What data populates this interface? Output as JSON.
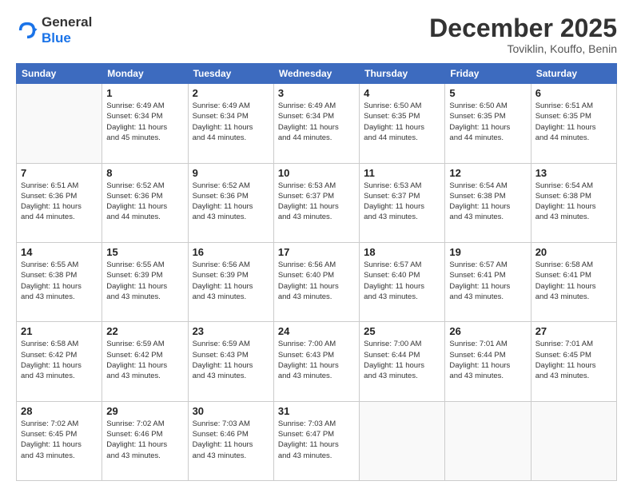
{
  "logo": {
    "line1": "General",
    "line2": "Blue"
  },
  "header": {
    "month": "December 2025",
    "location": "Toviklin, Kouffo, Benin"
  },
  "weekdays": [
    "Sunday",
    "Monday",
    "Tuesday",
    "Wednesday",
    "Thursday",
    "Friday",
    "Saturday"
  ],
  "weeks": [
    [
      {
        "day": "",
        "info": ""
      },
      {
        "day": "1",
        "info": "Sunrise: 6:49 AM\nSunset: 6:34 PM\nDaylight: 11 hours\nand 45 minutes."
      },
      {
        "day": "2",
        "info": "Sunrise: 6:49 AM\nSunset: 6:34 PM\nDaylight: 11 hours\nand 44 minutes."
      },
      {
        "day": "3",
        "info": "Sunrise: 6:49 AM\nSunset: 6:34 PM\nDaylight: 11 hours\nand 44 minutes."
      },
      {
        "day": "4",
        "info": "Sunrise: 6:50 AM\nSunset: 6:35 PM\nDaylight: 11 hours\nand 44 minutes."
      },
      {
        "day": "5",
        "info": "Sunrise: 6:50 AM\nSunset: 6:35 PM\nDaylight: 11 hours\nand 44 minutes."
      },
      {
        "day": "6",
        "info": "Sunrise: 6:51 AM\nSunset: 6:35 PM\nDaylight: 11 hours\nand 44 minutes."
      }
    ],
    [
      {
        "day": "7",
        "info": "Sunrise: 6:51 AM\nSunset: 6:36 PM\nDaylight: 11 hours\nand 44 minutes."
      },
      {
        "day": "8",
        "info": "Sunrise: 6:52 AM\nSunset: 6:36 PM\nDaylight: 11 hours\nand 44 minutes."
      },
      {
        "day": "9",
        "info": "Sunrise: 6:52 AM\nSunset: 6:36 PM\nDaylight: 11 hours\nand 43 minutes."
      },
      {
        "day": "10",
        "info": "Sunrise: 6:53 AM\nSunset: 6:37 PM\nDaylight: 11 hours\nand 43 minutes."
      },
      {
        "day": "11",
        "info": "Sunrise: 6:53 AM\nSunset: 6:37 PM\nDaylight: 11 hours\nand 43 minutes."
      },
      {
        "day": "12",
        "info": "Sunrise: 6:54 AM\nSunset: 6:38 PM\nDaylight: 11 hours\nand 43 minutes."
      },
      {
        "day": "13",
        "info": "Sunrise: 6:54 AM\nSunset: 6:38 PM\nDaylight: 11 hours\nand 43 minutes."
      }
    ],
    [
      {
        "day": "14",
        "info": "Sunrise: 6:55 AM\nSunset: 6:38 PM\nDaylight: 11 hours\nand 43 minutes."
      },
      {
        "day": "15",
        "info": "Sunrise: 6:55 AM\nSunset: 6:39 PM\nDaylight: 11 hours\nand 43 minutes."
      },
      {
        "day": "16",
        "info": "Sunrise: 6:56 AM\nSunset: 6:39 PM\nDaylight: 11 hours\nand 43 minutes."
      },
      {
        "day": "17",
        "info": "Sunrise: 6:56 AM\nSunset: 6:40 PM\nDaylight: 11 hours\nand 43 minutes."
      },
      {
        "day": "18",
        "info": "Sunrise: 6:57 AM\nSunset: 6:40 PM\nDaylight: 11 hours\nand 43 minutes."
      },
      {
        "day": "19",
        "info": "Sunrise: 6:57 AM\nSunset: 6:41 PM\nDaylight: 11 hours\nand 43 minutes."
      },
      {
        "day": "20",
        "info": "Sunrise: 6:58 AM\nSunset: 6:41 PM\nDaylight: 11 hours\nand 43 minutes."
      }
    ],
    [
      {
        "day": "21",
        "info": "Sunrise: 6:58 AM\nSunset: 6:42 PM\nDaylight: 11 hours\nand 43 minutes."
      },
      {
        "day": "22",
        "info": "Sunrise: 6:59 AM\nSunset: 6:42 PM\nDaylight: 11 hours\nand 43 minutes."
      },
      {
        "day": "23",
        "info": "Sunrise: 6:59 AM\nSunset: 6:43 PM\nDaylight: 11 hours\nand 43 minutes."
      },
      {
        "day": "24",
        "info": "Sunrise: 7:00 AM\nSunset: 6:43 PM\nDaylight: 11 hours\nand 43 minutes."
      },
      {
        "day": "25",
        "info": "Sunrise: 7:00 AM\nSunset: 6:44 PM\nDaylight: 11 hours\nand 43 minutes."
      },
      {
        "day": "26",
        "info": "Sunrise: 7:01 AM\nSunset: 6:44 PM\nDaylight: 11 hours\nand 43 minutes."
      },
      {
        "day": "27",
        "info": "Sunrise: 7:01 AM\nSunset: 6:45 PM\nDaylight: 11 hours\nand 43 minutes."
      }
    ],
    [
      {
        "day": "28",
        "info": "Sunrise: 7:02 AM\nSunset: 6:45 PM\nDaylight: 11 hours\nand 43 minutes."
      },
      {
        "day": "29",
        "info": "Sunrise: 7:02 AM\nSunset: 6:46 PM\nDaylight: 11 hours\nand 43 minutes."
      },
      {
        "day": "30",
        "info": "Sunrise: 7:03 AM\nSunset: 6:46 PM\nDaylight: 11 hours\nand 43 minutes."
      },
      {
        "day": "31",
        "info": "Sunrise: 7:03 AM\nSunset: 6:47 PM\nDaylight: 11 hours\nand 43 minutes."
      },
      {
        "day": "",
        "info": ""
      },
      {
        "day": "",
        "info": ""
      },
      {
        "day": "",
        "info": ""
      }
    ]
  ]
}
